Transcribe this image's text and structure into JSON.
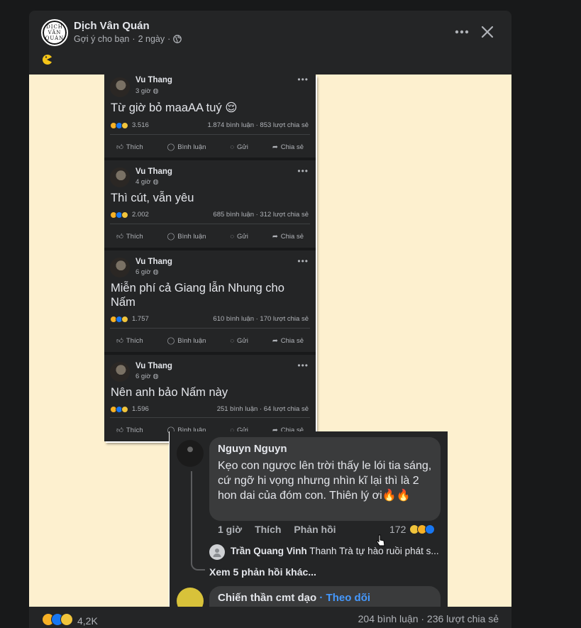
{
  "header": {
    "page_name": "Dịch Vân Quán",
    "avatar_text_lines": [
      "DỊCH",
      "VÂN",
      "QUÁN"
    ],
    "meta_suggested": "Gợi ý cho bạn",
    "meta_sep": "·",
    "meta_time": "2 ngày",
    "meta_sep2": "·"
  },
  "icons": {
    "more": "more-horizontal-icon",
    "close": "close-icon",
    "globe": "globe-icon",
    "caption": "pacman-emoji-icon"
  },
  "colors": {
    "modal_bg": "#242526",
    "photo_bg": "#fdf0cf",
    "link_blue": "#4599ff"
  },
  "photo": {
    "posts": [
      {
        "author": "Vu Thang",
        "time": "3 giờ",
        "text": "Từ giờ bỏ maaAA tuý 😌",
        "reactions": "3.516",
        "stats": "1.874 bình luận · 853 lượt chia sẻ"
      },
      {
        "author": "Vu Thang",
        "time": "4 giờ",
        "text": "Thì cút, vẫn yêu",
        "reactions": "2.002",
        "stats": "685 bình luận · 312 lượt chia sẻ"
      },
      {
        "author": "Vu Thang",
        "time": "6 giờ",
        "text": "Miễn phí cả Giang lẫn Nhung cho Nấm",
        "reactions": "1.757",
        "stats": "610 bình luận · 170 lượt chia sẻ"
      },
      {
        "author": "Vu Thang",
        "time": "6 giờ",
        "text": "Nên anh bảo Nấm này",
        "reactions": "1.596",
        "stats": "251 bình luận · 64 lượt chia sẻ"
      }
    ],
    "actions": [
      "Thích",
      "Bình luận",
      "Gửi",
      "Chia sẻ"
    ],
    "comment": {
      "author": "Nguyn Nguyn",
      "text": "Kẹo con ngược lên trời thấy le lói tia sáng, cứ ngỡ hi vọng nhưng nhìn kĩ lại thì là 2 hon dai của đóm con. Thiên lý ơi🔥🔥",
      "time": "1 giờ",
      "like": "Thích",
      "reply": "Phản hồi",
      "count": "172"
    },
    "reply": {
      "author": "Trần Quang Vinh",
      "text": "Thanh Trà tự hào ruồi phát s..."
    },
    "more_replies": "Xem 5 phản hồi khác...",
    "comment2": {
      "author": "Chiến thần cmt dạo",
      "sep": "·",
      "follow": "Theo dõi"
    }
  },
  "footer": {
    "reactions_count": "4,2K",
    "stats": "204 bình luận · 236 lượt chia sẻ"
  }
}
